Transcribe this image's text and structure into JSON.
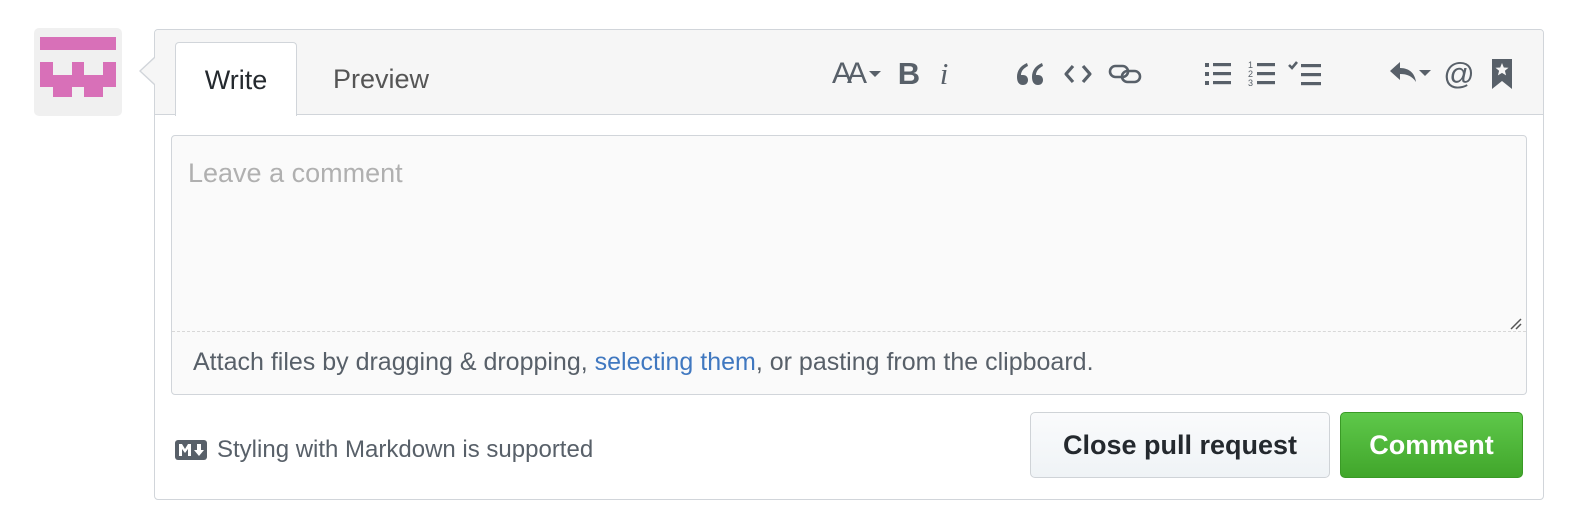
{
  "tabs": {
    "write_label": "Write",
    "preview_label": "Preview"
  },
  "toolbar": {
    "icons": [
      "text-size-icon",
      "bold-icon",
      "italic-icon",
      "quote-icon",
      "code-icon",
      "link-icon",
      "unordered-list-icon",
      "ordered-list-icon",
      "task-list-icon",
      "reply-icon",
      "mention-icon",
      "bookmark-icon"
    ],
    "bold_glyph": "B",
    "italic_glyph": "i",
    "mention_glyph": "@",
    "text_size_glyph": "AA"
  },
  "editor": {
    "placeholder": "Leave a comment",
    "value": ""
  },
  "attach": {
    "prefix": "Attach files by dragging & dropping, ",
    "link": "selecting them",
    "suffix": ", or pasting from the clipboard."
  },
  "footer": {
    "markdown_note": "Styling with Markdown is supported",
    "close_button": "Close pull request",
    "comment_button": "Comment"
  },
  "colors": {
    "avatar": "#d870b8",
    "link": "#4078c0",
    "primary_button": "#41a62b"
  }
}
